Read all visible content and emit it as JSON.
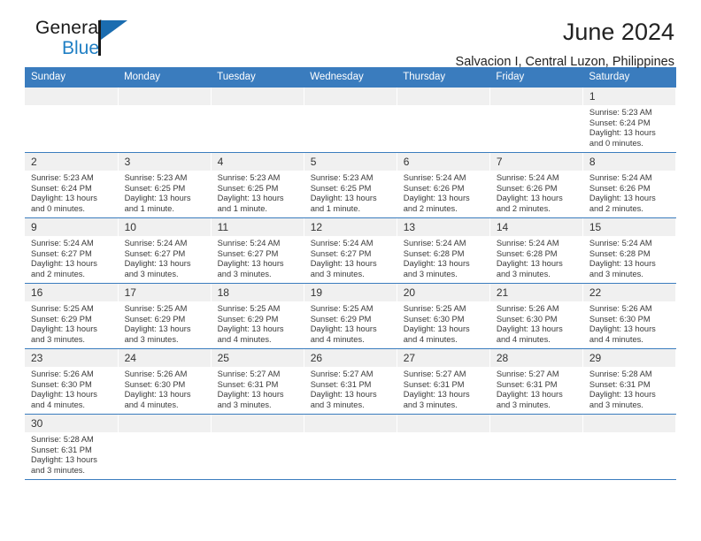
{
  "brand": {
    "line1": "General",
    "line2": "Blue",
    "flag_color": "#1a6cb0",
    "blue_text_color": "#1f7fc4"
  },
  "header": {
    "title": "June 2024",
    "subtitle": "Salvacion I, Central Luzon, Philippines"
  },
  "theme": {
    "header_bg": "#3a7cbe",
    "daynum_bg": "#f0f0f0",
    "row_divider": "#3a7cbe"
  },
  "weekday_headers": [
    "Sunday",
    "Monday",
    "Tuesday",
    "Wednesday",
    "Thursday",
    "Friday",
    "Saturday"
  ],
  "labels": {
    "sunrise_prefix": "Sunrise:",
    "sunset_prefix": "Sunset:",
    "daylight_prefix": "Daylight:"
  },
  "weeks": [
    [
      {
        "empty": true
      },
      {
        "empty": true
      },
      {
        "empty": true
      },
      {
        "empty": true
      },
      {
        "empty": true
      },
      {
        "empty": true
      },
      {
        "day": "1",
        "sunrise": "Sunrise: 5:23 AM",
        "sunset": "Sunset: 6:24 PM",
        "daylight": "Daylight: 13 hours and 0 minutes."
      }
    ],
    [
      {
        "day": "2",
        "sunrise": "Sunrise: 5:23 AM",
        "sunset": "Sunset: 6:24 PM",
        "daylight": "Daylight: 13 hours and 0 minutes."
      },
      {
        "day": "3",
        "sunrise": "Sunrise: 5:23 AM",
        "sunset": "Sunset: 6:25 PM",
        "daylight": "Daylight: 13 hours and 1 minute."
      },
      {
        "day": "4",
        "sunrise": "Sunrise: 5:23 AM",
        "sunset": "Sunset: 6:25 PM",
        "daylight": "Daylight: 13 hours and 1 minute."
      },
      {
        "day": "5",
        "sunrise": "Sunrise: 5:23 AM",
        "sunset": "Sunset: 6:25 PM",
        "daylight": "Daylight: 13 hours and 1 minute."
      },
      {
        "day": "6",
        "sunrise": "Sunrise: 5:24 AM",
        "sunset": "Sunset: 6:26 PM",
        "daylight": "Daylight: 13 hours and 2 minutes."
      },
      {
        "day": "7",
        "sunrise": "Sunrise: 5:24 AM",
        "sunset": "Sunset: 6:26 PM",
        "daylight": "Daylight: 13 hours and 2 minutes."
      },
      {
        "day": "8",
        "sunrise": "Sunrise: 5:24 AM",
        "sunset": "Sunset: 6:26 PM",
        "daylight": "Daylight: 13 hours and 2 minutes."
      }
    ],
    [
      {
        "day": "9",
        "sunrise": "Sunrise: 5:24 AM",
        "sunset": "Sunset: 6:27 PM",
        "daylight": "Daylight: 13 hours and 2 minutes."
      },
      {
        "day": "10",
        "sunrise": "Sunrise: 5:24 AM",
        "sunset": "Sunset: 6:27 PM",
        "daylight": "Daylight: 13 hours and 3 minutes."
      },
      {
        "day": "11",
        "sunrise": "Sunrise: 5:24 AM",
        "sunset": "Sunset: 6:27 PM",
        "daylight": "Daylight: 13 hours and 3 minutes."
      },
      {
        "day": "12",
        "sunrise": "Sunrise: 5:24 AM",
        "sunset": "Sunset: 6:27 PM",
        "daylight": "Daylight: 13 hours and 3 minutes."
      },
      {
        "day": "13",
        "sunrise": "Sunrise: 5:24 AM",
        "sunset": "Sunset: 6:28 PM",
        "daylight": "Daylight: 13 hours and 3 minutes."
      },
      {
        "day": "14",
        "sunrise": "Sunrise: 5:24 AM",
        "sunset": "Sunset: 6:28 PM",
        "daylight": "Daylight: 13 hours and 3 minutes."
      },
      {
        "day": "15",
        "sunrise": "Sunrise: 5:24 AM",
        "sunset": "Sunset: 6:28 PM",
        "daylight": "Daylight: 13 hours and 3 minutes."
      }
    ],
    [
      {
        "day": "16",
        "sunrise": "Sunrise: 5:25 AM",
        "sunset": "Sunset: 6:29 PM",
        "daylight": "Daylight: 13 hours and 3 minutes."
      },
      {
        "day": "17",
        "sunrise": "Sunrise: 5:25 AM",
        "sunset": "Sunset: 6:29 PM",
        "daylight": "Daylight: 13 hours and 3 minutes."
      },
      {
        "day": "18",
        "sunrise": "Sunrise: 5:25 AM",
        "sunset": "Sunset: 6:29 PM",
        "daylight": "Daylight: 13 hours and 4 minutes."
      },
      {
        "day": "19",
        "sunrise": "Sunrise: 5:25 AM",
        "sunset": "Sunset: 6:29 PM",
        "daylight": "Daylight: 13 hours and 4 minutes."
      },
      {
        "day": "20",
        "sunrise": "Sunrise: 5:25 AM",
        "sunset": "Sunset: 6:30 PM",
        "daylight": "Daylight: 13 hours and 4 minutes."
      },
      {
        "day": "21",
        "sunrise": "Sunrise: 5:26 AM",
        "sunset": "Sunset: 6:30 PM",
        "daylight": "Daylight: 13 hours and 4 minutes."
      },
      {
        "day": "22",
        "sunrise": "Sunrise: 5:26 AM",
        "sunset": "Sunset: 6:30 PM",
        "daylight": "Daylight: 13 hours and 4 minutes."
      }
    ],
    [
      {
        "day": "23",
        "sunrise": "Sunrise: 5:26 AM",
        "sunset": "Sunset: 6:30 PM",
        "daylight": "Daylight: 13 hours and 4 minutes."
      },
      {
        "day": "24",
        "sunrise": "Sunrise: 5:26 AM",
        "sunset": "Sunset: 6:30 PM",
        "daylight": "Daylight: 13 hours and 4 minutes."
      },
      {
        "day": "25",
        "sunrise": "Sunrise: 5:27 AM",
        "sunset": "Sunset: 6:31 PM",
        "daylight": "Daylight: 13 hours and 3 minutes."
      },
      {
        "day": "26",
        "sunrise": "Sunrise: 5:27 AM",
        "sunset": "Sunset: 6:31 PM",
        "daylight": "Daylight: 13 hours and 3 minutes."
      },
      {
        "day": "27",
        "sunrise": "Sunrise: 5:27 AM",
        "sunset": "Sunset: 6:31 PM",
        "daylight": "Daylight: 13 hours and 3 minutes."
      },
      {
        "day": "28",
        "sunrise": "Sunrise: 5:27 AM",
        "sunset": "Sunset: 6:31 PM",
        "daylight": "Daylight: 13 hours and 3 minutes."
      },
      {
        "day": "29",
        "sunrise": "Sunrise: 5:28 AM",
        "sunset": "Sunset: 6:31 PM",
        "daylight": "Daylight: 13 hours and 3 minutes."
      }
    ],
    [
      {
        "day": "30",
        "sunrise": "Sunrise: 5:28 AM",
        "sunset": "Sunset: 6:31 PM",
        "daylight": "Daylight: 13 hours and 3 minutes."
      },
      {
        "empty": true
      },
      {
        "empty": true
      },
      {
        "empty": true
      },
      {
        "empty": true
      },
      {
        "empty": true
      },
      {
        "empty": true
      }
    ]
  ]
}
